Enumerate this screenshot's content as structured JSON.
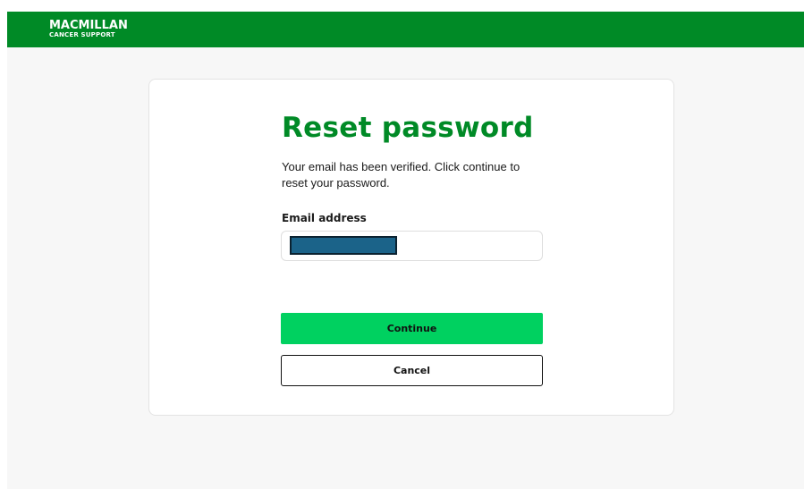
{
  "header": {
    "logo_line1": "MACMILLAN",
    "logo_line2": "CANCER SUPPORT",
    "brand_color": "#008a26"
  },
  "card": {
    "title": "Reset password",
    "description": "Your email has been verified. Click continue to reset your password.",
    "email_label": "Email address",
    "email_value": "",
    "continue_label": "Continue",
    "cancel_label": "Cancel",
    "continue_color": "#00d160"
  }
}
